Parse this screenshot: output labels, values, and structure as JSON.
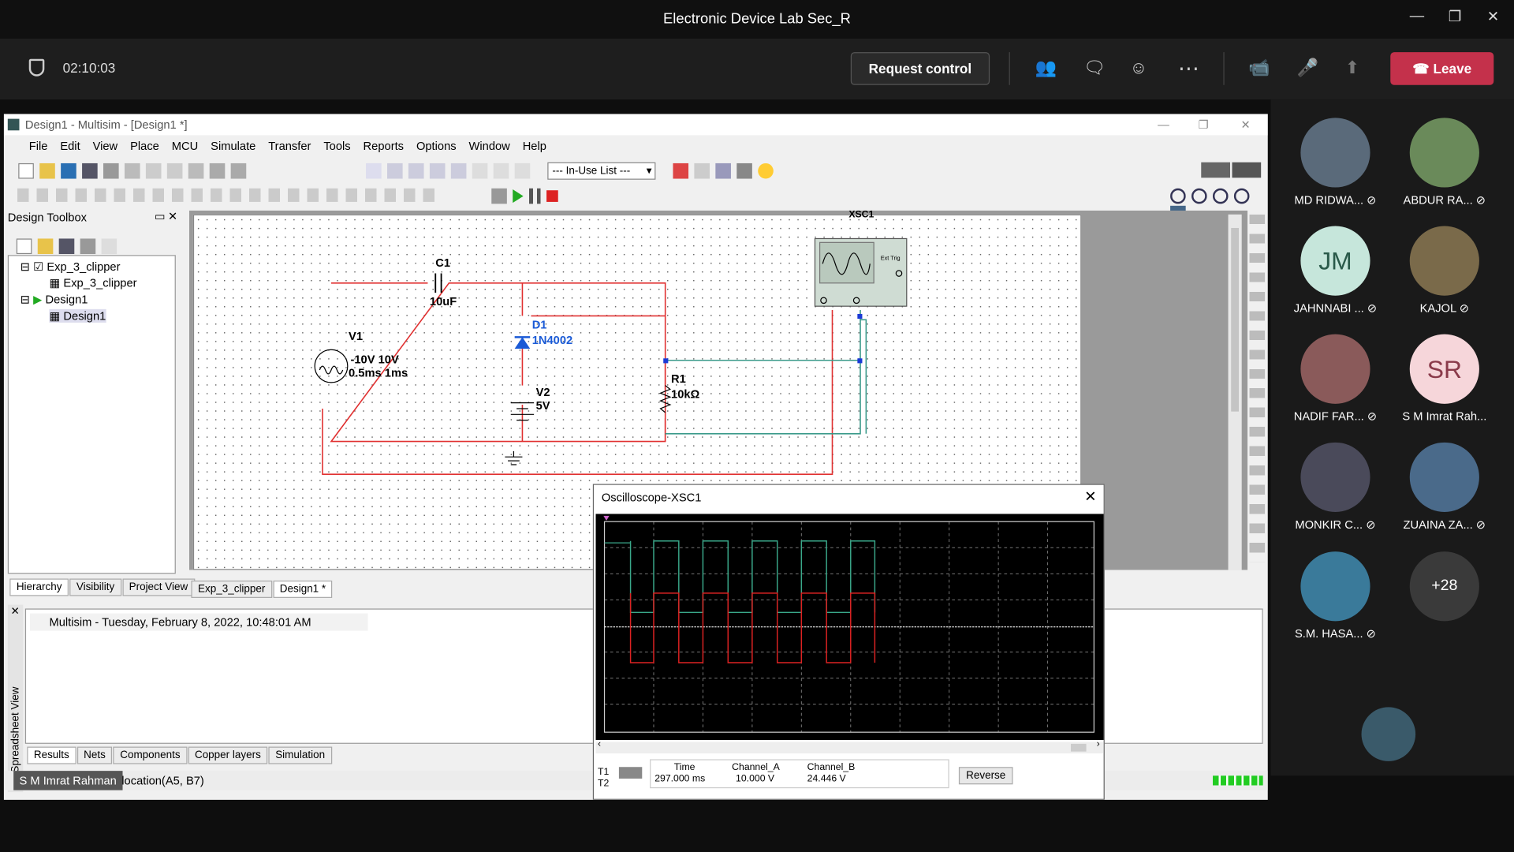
{
  "window": {
    "title": "Electronic Device Lab Sec_R"
  },
  "meeting": {
    "timer": "02:10:03",
    "request_control": "Request control",
    "leave": "Leave"
  },
  "multisim": {
    "title": "Design1 - Multisim - [Design1 *]",
    "menu": [
      "File",
      "Edit",
      "View",
      "Place",
      "MCU",
      "Simulate",
      "Transfer",
      "Tools",
      "Reports",
      "Options",
      "Window",
      "Help"
    ],
    "inuse_list": "--- In-Use List ---",
    "toolbox_title": "Design Toolbox",
    "tree": [
      "Exp_3_clipper",
      "Exp_3_clipper",
      "Design1",
      "Design1"
    ],
    "toolbox_tabs": [
      "Hierarchy",
      "Visibility",
      "Project View"
    ],
    "doc_tabs": [
      "Exp_3_clipper",
      "Design1 *"
    ],
    "log": "Multisim  -  Tuesday, February 8, 2022, 10:48:01 AM",
    "bottom_tabs": [
      "Results",
      "Nets",
      "Components",
      "Copper layers",
      "Simulation"
    ],
    "spreadsheet_label": "Spreadsheet View",
    "status": "location(A5, B7)",
    "presenter": "S M Imrat Rahman",
    "circuit": {
      "c1_name": "C1",
      "c1_val": "10uF",
      "d1_name": "D1",
      "d1_val": "1N4002",
      "v1_name": "V1",
      "v1_val1": "-10V 10V",
      "v1_val2": "0.5ms 1ms",
      "v2_name": "V2",
      "v2_val": "5V",
      "r1_name": "R1",
      "r1_val": "10kΩ",
      "xsc_label": "XSC1",
      "ext_trig": "Ext Trig"
    },
    "scope": {
      "title": "Oscilloscope-XSC1",
      "t1": "T1",
      "t2": "T2",
      "time_label": "Time",
      "time_val": "297.000 ms",
      "cha_label": "Channel_A",
      "cha_val": "10.000 V",
      "chb_label": "Channel_B",
      "chb_val": "24.446 V",
      "reverse": "Reverse"
    }
  },
  "participants": [
    {
      "name": "MD RIDWA...",
      "muted": true,
      "color": "#5a6a7a"
    },
    {
      "name": "ABDUR RA...",
      "muted": true,
      "color": "#6a8a5a"
    },
    {
      "name": "JAHNNABI ...",
      "muted": true,
      "initials": "JM",
      "color": "#c6e6db"
    },
    {
      "name": "KAJOL",
      "muted": true,
      "color": "#7a6a4a"
    },
    {
      "name": "NADIF FAR...",
      "muted": true,
      "color": "#8a5a5a"
    },
    {
      "name": "S M Imrat Rah...",
      "muted": false,
      "initials": "SR",
      "color": "#f6d6da"
    },
    {
      "name": "MONKIR C...",
      "muted": true,
      "color": "#4a4a5a"
    },
    {
      "name": "ZUAINA ZA...",
      "muted": true,
      "color": "#4a6a8a"
    },
    {
      "name": "S.M. HASA...",
      "muted": true,
      "color": "#3a7a9a"
    }
  ],
  "overflow": "+28"
}
